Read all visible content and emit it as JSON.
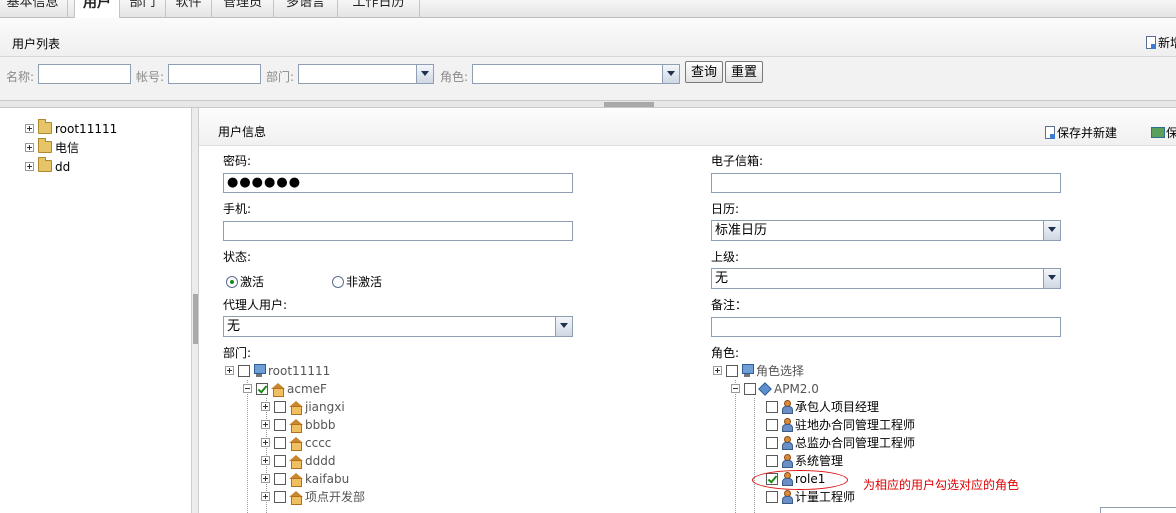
{
  "tabs": [
    {
      "label": "基本信息",
      "active": false
    },
    {
      "label": "用户",
      "active": true
    },
    {
      "label": "部门",
      "active": false
    },
    {
      "label": "软件",
      "active": false
    },
    {
      "label": "管理员",
      "active": false
    },
    {
      "label": "多语言",
      "active": false
    },
    {
      "label": "工作日历",
      "active": false
    }
  ],
  "list": {
    "title": "用户列表",
    "new_label": "新增"
  },
  "search": {
    "name_label": "名称:",
    "account_label": "帐号:",
    "dept_label": "部门:",
    "role_label": "角色:",
    "query_button": "查询",
    "reset_button": "重置"
  },
  "left_tree": [
    {
      "label": "root11111"
    },
    {
      "label": "电信"
    },
    {
      "label": "dd"
    }
  ],
  "form": {
    "title": "用户信息",
    "save_new_label": "保存并新建",
    "save_label": "保",
    "password_label": "密码:",
    "password_value": "●●●●●●",
    "email_label": "电子信箱:",
    "email_value": "",
    "mobile_label": "手机:",
    "mobile_value": "",
    "calendar_label": "日历:",
    "calendar_value": "标准日历",
    "status_label": "状态:",
    "status_active": "激活",
    "status_inactive": "非激活",
    "status_selected": "激活",
    "superior_label": "上级:",
    "superior_value": "无",
    "agent_label": "代理人用户:",
    "agent_value": "无",
    "remark_label": "备注：",
    "remark_value": "",
    "dept_label": "部门:",
    "role_label": "角色:"
  },
  "dept_tree": [
    {
      "label": "root11111",
      "checked": false
    },
    {
      "label": "acmeF",
      "checked": true
    },
    {
      "label": "jiangxi",
      "checked": false
    },
    {
      "label": "bbbb",
      "checked": false
    },
    {
      "label": "cccc",
      "checked": false
    },
    {
      "label": "dddd",
      "checked": false
    },
    {
      "label": "kaifabu",
      "checked": false
    },
    {
      "label": "项点开发部",
      "checked": false
    }
  ],
  "role_tree": [
    {
      "label": "角色选择",
      "checked": false
    },
    {
      "label": "APM2.0",
      "checked": false
    },
    {
      "label": "承包人项目经理",
      "checked": false
    },
    {
      "label": "驻地办合同管理工程师",
      "checked": false
    },
    {
      "label": "总监办合同管理工程师",
      "checked": false
    },
    {
      "label": "系统管理",
      "checked": false
    },
    {
      "label": "role1",
      "checked": true
    },
    {
      "label": "计量工程师",
      "checked": false
    }
  ],
  "annotation": "为相应的用户勾选对应的角色",
  "colors": {
    "annotation": "#e00000",
    "check": "#1a8a1a",
    "input_border": "#8f9fb3"
  }
}
